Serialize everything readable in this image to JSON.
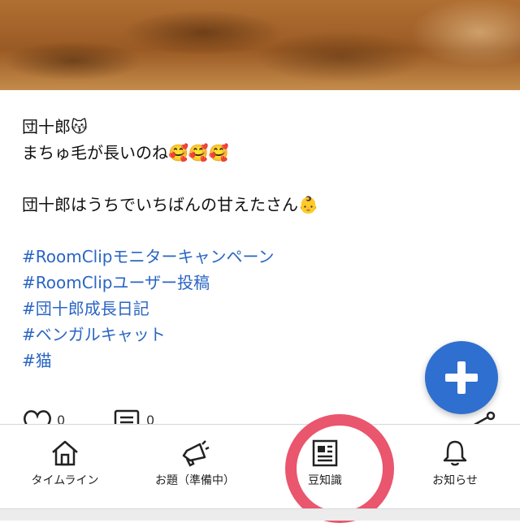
{
  "caption": {
    "line1": "団十郎😽",
    "line2": "まちゅ毛が長いのね🥰🥰🥰",
    "line3": "団十郎はうちでいちばんの甘えたさん👶",
    "hashtags": [
      "#RoomClipモニターキャンペーン",
      "#RoomClipユーザー投稿",
      "#団十郎成長日記",
      "#ベンガルキャット",
      "#猫"
    ]
  },
  "actions": {
    "like_count": "0",
    "comment_count": "0"
  },
  "tabbar": {
    "tabs": [
      {
        "label": "タイムライン",
        "icon": "home-icon"
      },
      {
        "label": "お題（準備中）",
        "icon": "megaphone-icon"
      },
      {
        "label": "豆知識",
        "icon": "article-icon"
      },
      {
        "label": "お知らせ",
        "icon": "bell-icon"
      }
    ]
  },
  "colors": {
    "accent": "#2f6fcf",
    "hashtag": "#2a65c4",
    "highlight": "#e9566d"
  }
}
